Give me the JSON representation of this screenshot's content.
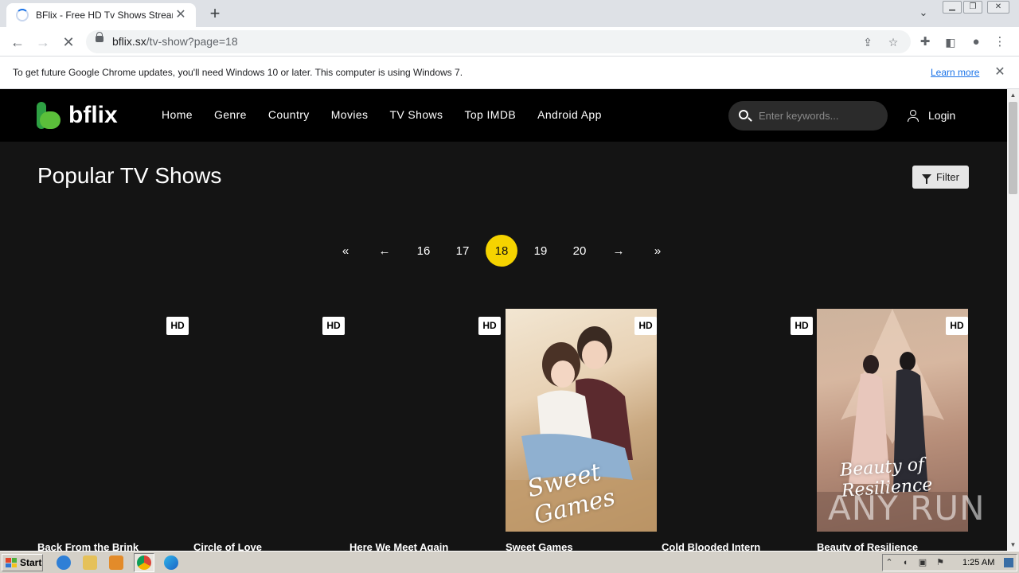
{
  "browser": {
    "tab_title": "BFlix - Free HD Tv Shows Streaming",
    "url_host": "bflix.sx",
    "url_path": "/tv-show?page=18",
    "infobar_text": "To get future Google Chrome updates, you'll need Windows 10 or later. This computer is using Windows 7.",
    "infobar_link": "Learn more"
  },
  "site": {
    "logo_text": "bflix",
    "nav": [
      "Home",
      "Genre",
      "Country",
      "Movies",
      "TV Shows",
      "Top IMDB",
      "Android App"
    ],
    "search_placeholder": "Enter keywords...",
    "login_label": "Login",
    "page_title": "Popular TV Shows",
    "filter_label": "Filter",
    "pagination": {
      "first": "«",
      "prev": "←",
      "pages": [
        "16",
        "17",
        "18",
        "19",
        "20"
      ],
      "current": "18",
      "next": "→",
      "last": "»"
    },
    "shows": [
      {
        "title": "Back From the Brink",
        "badge": "HD"
      },
      {
        "title": "Circle of Love",
        "badge": "HD"
      },
      {
        "title": "Here We Meet Again",
        "badge": "HD"
      },
      {
        "title": "Sweet Games",
        "badge": "HD",
        "poster_text": "Sweet Games"
      },
      {
        "title": "Cold Blooded Intern",
        "badge": "HD"
      },
      {
        "title": "Beauty of Resilience",
        "badge": "HD",
        "poster_text": "Beauty of Resilience"
      }
    ]
  },
  "overlay": {
    "watermark": "ANY RUN"
  },
  "taskbar": {
    "start_label": "Start",
    "clock": "1:25 AM"
  },
  "colors": {
    "accent": "#f5d300",
    "page_bg": "#141414",
    "header_bg": "#000000",
    "logo_green": "#5bbf3a"
  }
}
